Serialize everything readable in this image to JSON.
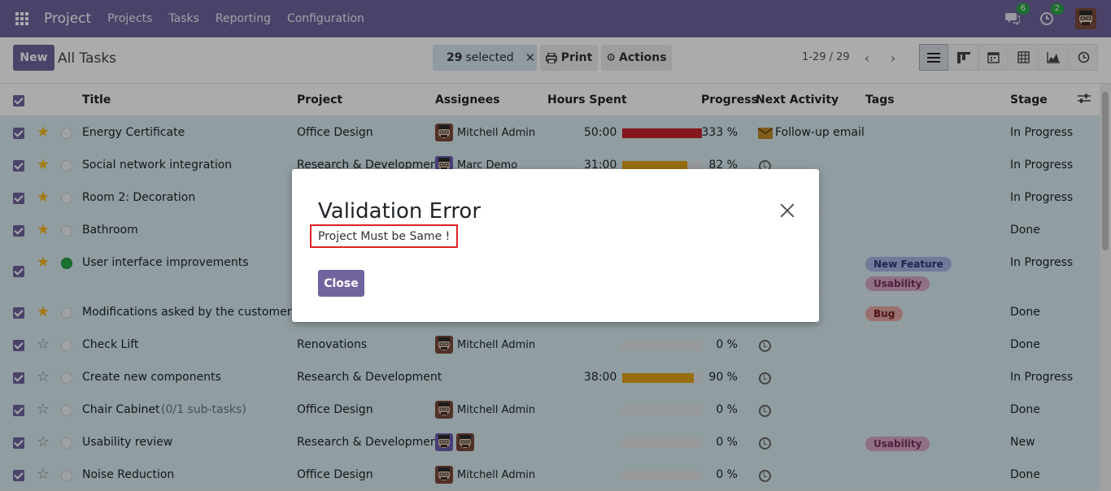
{
  "navbar": {
    "app_name": "Project",
    "menu": [
      "Projects",
      "Tasks",
      "Reporting",
      "Configuration"
    ],
    "chat_count": "6",
    "activity_count": "2"
  },
  "control": {
    "new_label": "New",
    "breadcrumb": "All Tasks",
    "selected_count": "29",
    "selected_label": "selected",
    "print_label": "Print",
    "actions_label": "Actions",
    "pager": "1-29 / 29",
    "views": [
      "list-view-icon",
      "kanban-view-icon",
      "calendar-view-icon",
      "pivot-view-icon",
      "graph-view-icon",
      "activity-view-icon"
    ],
    "active_view": "list-view-icon"
  },
  "table": {
    "headers": {
      "title": "Title",
      "project": "Project",
      "assignees": "Assignees",
      "hours": "Hours Spent",
      "progress": "Progress",
      "activity": "Next Activity",
      "tags": "Tags",
      "stage": "Stage"
    },
    "rows": [
      {
        "title": "Energy Certificate",
        "subtasks": "",
        "starred": true,
        "status": "normal",
        "project": "Office Design",
        "assignee": "Mitchell Admin",
        "assignee_count": 1,
        "hours": "50:00",
        "progress": 100,
        "progress_text": "333 %",
        "progress_color": "#c4232a",
        "activity": "Follow-up email",
        "activity_icon": "envelope-icon",
        "tags": [],
        "stage": "In Progress"
      },
      {
        "title": "Social network integration",
        "subtasks": "",
        "starred": true,
        "status": "normal",
        "project": "Research & Development",
        "assignee": "Marc Demo",
        "assignee_count": 1,
        "hours": "31:00",
        "progress": 82,
        "progress_text": "82 %",
        "progress_color": "#e2a414",
        "activity": "",
        "activity_icon": "clock-icon",
        "tags": [],
        "stage": "In Progress"
      },
      {
        "title": "Room 2: Decoration",
        "subtasks": "",
        "starred": true,
        "status": "normal",
        "project": "",
        "assignee": "",
        "assignee_count": 0,
        "hours": "",
        "progress": -1,
        "progress_text": "",
        "progress_color": "",
        "activity": "",
        "activity_icon": "",
        "tags": [],
        "stage": "In Progress"
      },
      {
        "title": "Bathroom",
        "subtasks": "",
        "starred": true,
        "status": "normal",
        "project": "",
        "assignee": "",
        "assignee_count": 0,
        "hours": "",
        "progress": -1,
        "progress_text": "",
        "progress_color": "",
        "activity": "",
        "activity_icon": "",
        "tags": [],
        "stage": "Done"
      },
      {
        "title": "User interface improvements",
        "subtasks": "",
        "starred": true,
        "status": "done",
        "project": "",
        "assignee": "",
        "assignee_count": 0,
        "hours": "",
        "progress": -1,
        "progress_text": "",
        "progress_color": "",
        "activity": "",
        "activity_icon": "",
        "tags": [
          {
            "label": "New Feature",
            "bg": "#a9b6e6",
            "fg": "#2b3a78"
          },
          {
            "label": "Usability",
            "bg": "#d7a7c5",
            "fg": "#7a2f5e"
          }
        ],
        "stage": "In Progress"
      },
      {
        "title": "Modifications asked by the customer",
        "subtasks": "",
        "starred": true,
        "status": "normal",
        "project": "",
        "assignee": "",
        "assignee_count": 0,
        "hours": "",
        "progress": -1,
        "progress_text": "",
        "progress_color": "",
        "activity": "",
        "activity_icon": "",
        "tags": [
          {
            "label": "Bug",
            "bg": "#e4a6a6",
            "fg": "#7a2020"
          }
        ],
        "stage": "Done"
      },
      {
        "title": "Check Lift",
        "subtasks": "",
        "starred": false,
        "status": "normal",
        "project": "Renovations",
        "assignee": "Mitchell Admin",
        "assignee_count": 1,
        "hours": "",
        "progress": 0,
        "progress_text": "0 %",
        "progress_color": "#e2a414",
        "activity": "",
        "activity_icon": "clock-icon",
        "tags": [],
        "stage": "Done"
      },
      {
        "title": "Create new components",
        "subtasks": "",
        "starred": false,
        "status": "normal",
        "project": "Research & Development",
        "assignee": "",
        "assignee_count": 0,
        "hours": "38:00",
        "progress": 90,
        "progress_text": "90 %",
        "progress_color": "#e2a414",
        "activity": "",
        "activity_icon": "clock-icon",
        "tags": [],
        "stage": "In Progress"
      },
      {
        "title": "Chair Cabinet",
        "subtasks": "(0/1 sub-tasks)",
        "starred": false,
        "status": "normal",
        "project": "Office Design",
        "assignee": "Mitchell Admin",
        "assignee_count": 1,
        "hours": "",
        "progress": 0,
        "progress_text": "0 %",
        "progress_color": "#e2a414",
        "activity": "",
        "activity_icon": "clock-icon",
        "tags": [],
        "stage": "Done"
      },
      {
        "title": "Usability review",
        "subtasks": "",
        "starred": false,
        "status": "normal",
        "project": "Research & Development",
        "assignee": "",
        "assignee_count": 2,
        "hours": "",
        "progress": 0,
        "progress_text": "0 %",
        "progress_color": "#e2a414",
        "activity": "",
        "activity_icon": "clock-icon",
        "tags": [
          {
            "label": "Usability",
            "bg": "#d7a7c5",
            "fg": "#7a2f5e"
          }
        ],
        "stage": "New"
      },
      {
        "title": "Noise Reduction",
        "subtasks": "",
        "starred": false,
        "status": "normal",
        "project": "Office Design",
        "assignee": "Mitchell Admin",
        "assignee_count": 1,
        "hours": "",
        "progress": 0,
        "progress_text": "0 %",
        "progress_color": "#e2a414",
        "activity": "",
        "activity_icon": "clock-icon",
        "tags": [],
        "stage": "Done"
      }
    ]
  },
  "modal": {
    "title": "Validation Error",
    "message": "Project Must be Same !",
    "close_label": "Close"
  },
  "colors": {
    "brand": "#71639e",
    "selected_row": "#d7eaf1",
    "error_border": "#dd2222"
  }
}
